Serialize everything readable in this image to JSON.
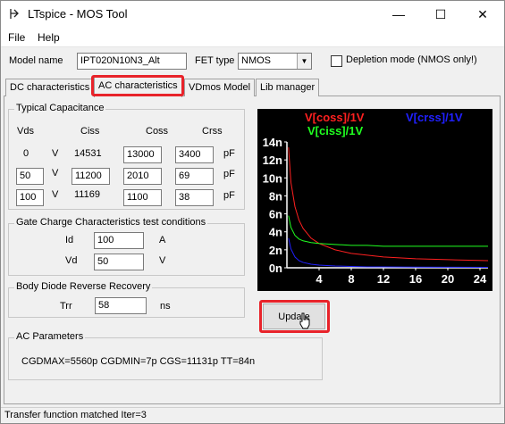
{
  "window": {
    "title": "LTspice - MOS Tool",
    "minimize": "—",
    "maximize": "☐",
    "close": "✕"
  },
  "menu": [
    "File",
    "Help"
  ],
  "top": {
    "model_name_label": "Model name",
    "model_name_value": "IPT020N10N3_Alt",
    "fet_type_label": "FET type",
    "fet_type_value": "NMOS",
    "depletion_label": "Depletion mode (NMOS only!)"
  },
  "tabs": [
    "DC characteristics",
    "AC characteristics",
    "VDmos Model",
    "Lib manager"
  ],
  "active_tab": 1,
  "capacitance": {
    "title": "Typical Capacitance",
    "headers": {
      "vds": "Vds",
      "ciss": "Ciss",
      "coss": "Coss",
      "crss": "Crss"
    },
    "rows": [
      {
        "vds": "0",
        "v": "V",
        "ciss": "14531",
        "coss": "13000",
        "crss": "3400",
        "unit": "pF"
      },
      {
        "vds": "50",
        "v": "V",
        "ciss": "11200",
        "coss": "2010",
        "crss": "69",
        "unit": "pF"
      },
      {
        "vds": "100",
        "v": "V",
        "ciss": "11169",
        "coss": "1100",
        "crss": "38",
        "unit": "pF"
      }
    ]
  },
  "gate_charge": {
    "title": "Gate Charge Characteristics test conditions",
    "id_label": "Id",
    "id_value": "100",
    "id_unit": "A",
    "vd_label": "Vd",
    "vd_value": "50",
    "vd_unit": "V"
  },
  "body_diode": {
    "title": "Body Diode Reverse Recovery",
    "trr_label": "Trr",
    "trr_value": "58",
    "trr_unit": "ns"
  },
  "ac_params": {
    "title": "AC Parameters",
    "text": "CGDMAX=5560p CGDMIN=7p CGS=11131p TT=84n"
  },
  "update_button": "Update",
  "status": "Transfer function matched Iter=3",
  "colors": {
    "highlight": "#e8232a",
    "coss": "#ff2020",
    "ciss": "#20ff20",
    "crss": "#2020ff",
    "axis": "#ffffff"
  },
  "chart_data": {
    "type": "line",
    "legend": [
      "V[coss]/1V",
      "V[ciss]/1V",
      "V[crss]/1V"
    ],
    "yticks": [
      "0n",
      "2n",
      "4n",
      "6n",
      "8n",
      "10n",
      "12n",
      "14n"
    ],
    "xticks": [
      "4",
      "8",
      "12",
      "16",
      "20",
      "24"
    ],
    "xlim": [
      0,
      25
    ],
    "ylim": [
      0,
      14
    ],
    "series": [
      {
        "name": "V[coss]/1V",
        "color": "#ff2020",
        "x": [
          0.2,
          0.5,
          1,
          1.5,
          2,
          3,
          4,
          6,
          8,
          10,
          12,
          16,
          20,
          25
        ],
        "y": [
          13.4,
          9.5,
          6.8,
          5.3,
          4.4,
          3.3,
          2.7,
          2.0,
          1.6,
          1.4,
          1.2,
          1.0,
          0.9,
          0.8
        ]
      },
      {
        "name": "V[ciss]/1V",
        "color": "#20ff20",
        "x": [
          0.2,
          0.5,
          1,
          1.5,
          2,
          3,
          4,
          6,
          8,
          10,
          12,
          16,
          20,
          25
        ],
        "y": [
          5.8,
          4.5,
          3.6,
          3.2,
          3.0,
          2.8,
          2.7,
          2.6,
          2.5,
          2.5,
          2.4,
          2.4,
          2.4,
          2.4
        ]
      },
      {
        "name": "V[crss]/1V",
        "color": "#2020ff",
        "x": [
          0.2,
          0.5,
          1,
          1.5,
          2,
          3,
          4,
          6,
          8,
          10,
          12,
          16,
          20,
          25
        ],
        "y": [
          3.3,
          2.1,
          1.2,
          0.8,
          0.6,
          0.4,
          0.3,
          0.2,
          0.15,
          0.1,
          0.1,
          0.08,
          0.06,
          0.05
        ]
      }
    ]
  }
}
